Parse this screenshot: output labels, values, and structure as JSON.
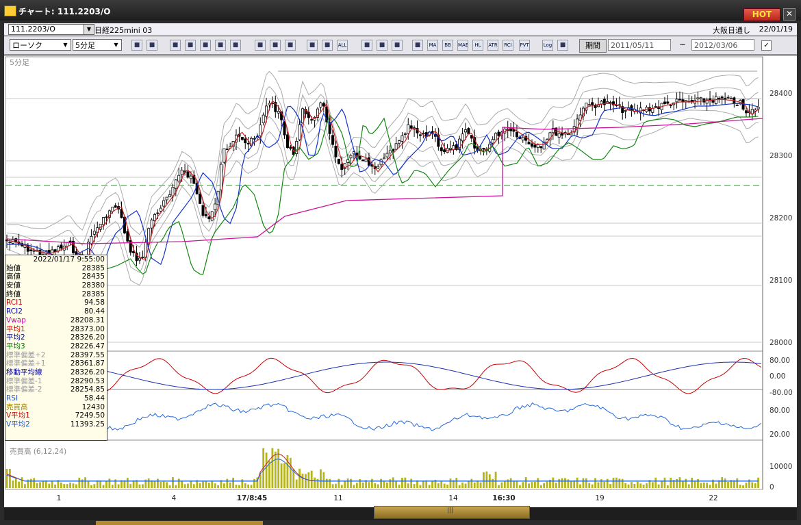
{
  "window": {
    "title": "チャート: 111.2203/O",
    "hot_label": "HOT",
    "close_glyph": "✕"
  },
  "symbol_bar": {
    "symbol": "111.2203/O",
    "instrument": "日経225mini 03",
    "exchange": "大阪日通し",
    "date": "22/01/19"
  },
  "toolbar": {
    "chart_type": "ローソク",
    "timeframe": "5分足",
    "buttons": [
      {
        "label": "",
        "icon": "zoom-icon"
      },
      {
        "label": "",
        "icon": "crosshair-icon"
      },
      {
        "label": "",
        "icon": "arrow-down-icon"
      },
      {
        "label": "",
        "icon": "magnifier-icon"
      },
      {
        "label": "",
        "icon": "bar-chart-icon"
      },
      {
        "label": "",
        "icon": "candle-icon"
      },
      {
        "label": "",
        "icon": "info-icon"
      },
      {
        "label": "",
        "icon": "pencil-icon"
      },
      {
        "label": "",
        "icon": "cursor-icon"
      },
      {
        "label": "",
        "icon": "undo-icon"
      },
      {
        "label": "",
        "icon": "split-icon"
      },
      {
        "label": "",
        "icon": "split-arrows-icon"
      },
      {
        "label": "ALL",
        "icon": "all-icon"
      },
      {
        "label": "",
        "icon": "settings-icon"
      },
      {
        "label": "",
        "icon": "brush-icon"
      },
      {
        "label": "",
        "icon": "palette-icon"
      },
      {
        "label": "",
        "icon": "grid-icon"
      },
      {
        "label": "MA",
        "icon": "ma-icon"
      },
      {
        "label": "BB",
        "icon": "bb-icon"
      },
      {
        "label": "MAE",
        "icon": "mae-icon"
      },
      {
        "label": "HL",
        "icon": "hl-icon"
      },
      {
        "label": "ATR",
        "icon": "atr-icon"
      },
      {
        "label": "RCI",
        "icon": "rci-icon"
      },
      {
        "label": "PVT",
        "icon": "pvt-icon"
      },
      {
        "label": "Log",
        "icon": "log-icon"
      },
      {
        "label": "",
        "icon": "export-icon"
      }
    ],
    "period_label": "期間",
    "date_from": "2011/05/11",
    "date_to": "2012/03/06",
    "tilde": "~"
  },
  "chart": {
    "main_label": "5分足",
    "volume_label": "売買高 (6,12,24)",
    "price_ticks": [
      "28400",
      "28300",
      "28200",
      "28100",
      "28000"
    ],
    "osc_ticks": [
      "80.00",
      "0.00",
      "-80.00"
    ],
    "rsi_ticks": [
      "80.00",
      "20.00"
    ],
    "vol_ticks": [
      "10000",
      "0"
    ],
    "x_labels": [
      {
        "text": "1",
        "bold": false
      },
      {
        "text": "4",
        "bold": false
      },
      {
        "text": "17/8:45",
        "bold": true
      },
      {
        "text": "11",
        "bold": false
      },
      {
        "text": "14",
        "bold": false
      },
      {
        "text": "16:30",
        "bold": true
      },
      {
        "text": "19",
        "bold": false
      },
      {
        "text": "22",
        "bold": false
      }
    ]
  },
  "info": {
    "datetime": "2022/01/17 9:55:00",
    "rows": [
      {
        "label": "始値",
        "value": "28385",
        "color": "#000000"
      },
      {
        "label": "高値",
        "value": "28435",
        "color": "#000000"
      },
      {
        "label": "安値",
        "value": "28380",
        "color": "#000000"
      },
      {
        "label": "終値",
        "value": "28385",
        "color": "#000000"
      },
      {
        "label": "RCI1",
        "value": "94.58",
        "color": "#cc0000"
      },
      {
        "label": "RCI2",
        "value": "80.44",
        "color": "#0000aa"
      },
      {
        "label": "Vwap",
        "value": "28208.31",
        "color": "#cc00aa"
      },
      {
        "label": "平均1",
        "value": "28373.00",
        "color": "#cc0000"
      },
      {
        "label": "平均2",
        "value": "28326.20",
        "color": "#000088"
      },
      {
        "label": "平均3",
        "value": "28226.47",
        "color": "#007700"
      },
      {
        "label": "標準偏差+2",
        "value": "28397.55",
        "color": "#999999"
      },
      {
        "label": "標準偏差+1",
        "value": "28361.87",
        "color": "#999999"
      },
      {
        "label": "移動平均線",
        "value": "28326.20",
        "color": "#0000aa"
      },
      {
        "label": "標準偏差-1",
        "value": "28290.53",
        "color": "#999999"
      },
      {
        "label": "標準偏差-2",
        "value": "28254.85",
        "color": "#999999"
      },
      {
        "label": "RSI",
        "value": "58.44",
        "color": "#2255cc"
      },
      {
        "label": "売買高",
        "value": "12430",
        "color": "#998800"
      },
      {
        "label": "V平均1",
        "value": "7249.50",
        "color": "#cc0000"
      },
      {
        "label": "V平均2",
        "value": "11393.25",
        "color": "#2255cc"
      }
    ]
  },
  "colors": {
    "rci1": "#cc0000",
    "rci2": "#1a2fb0",
    "rsi": "#2266dd",
    "vwap": "#cc1199",
    "avg1": "#cc2222",
    "avg2": "#1133cc",
    "avg3": "#118811",
    "bands": "#aaaaaa",
    "volume_bar": "#b5b51a",
    "dashed_line": "#2a9a2a"
  }
}
